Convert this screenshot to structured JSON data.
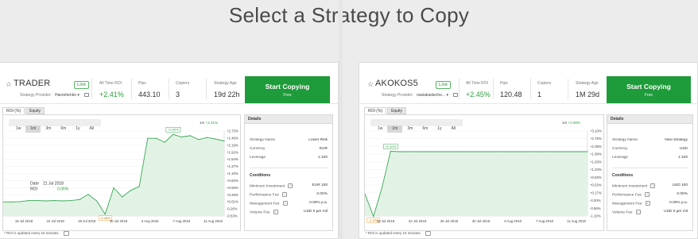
{
  "page": {
    "title": "Select a Strategy to Copy"
  },
  "colors": {
    "accent": "#1e9b3a",
    "chart_line": "#3aa655",
    "chart_fill": "#e2f3e5",
    "loss_marker": "#f0a030"
  },
  "cards": [
    {
      "name": "TRADER",
      "live_label": "Live",
      "provider_label": "Strategy Provider:",
      "provider_name": "Hareshenko ▾",
      "roi_label": "All Time ROI",
      "roi_value": "+2.41%",
      "pips_label": "Pips",
      "pips_value": "443.10",
      "copiers_label": "Copiers",
      "copiers_value": "3",
      "age_label": "Strategy Age",
      "age_value": "19d 22h",
      "copy_label": "Start Copying",
      "copy_sub": "Free",
      "tabs": [
        "ROI (%)",
        "Equity"
      ],
      "ranges": [
        "1w",
        "1m",
        "3m",
        "6m",
        "1y",
        "All"
      ],
      "active_range": "1m",
      "legend_range": "1m",
      "legend_value": "+2.41%",
      "yticks": [
        "+2.73%",
        "+2.46%",
        "+2.19%",
        "+1.92%",
        "+1.64%",
        "+1.37%",
        "+1.10%",
        "+0.82%",
        "+0.55%",
        "+0.28%",
        "+0.01%",
        "-0.26%",
        "-0.53%"
      ],
      "xticks": [
        "19 Jul 2018",
        "22 Jul 2018",
        "26 Jul 2018",
        "30 Jul 2018",
        "3 Aug 2018",
        "7 Aug 2018",
        "11 Aug 2018"
      ],
      "tooltip": {
        "date_label": "Date",
        "date_value": "21 Jul 2018",
        "roi_label": "ROI",
        "roi_value": "0.06%"
      },
      "peak_label": "+2.60%",
      "low_label": "-0.46%",
      "details_title": "Details",
      "details": [
        {
          "label": "Strategy Name",
          "value": "Lower Risk"
        },
        {
          "label": "Currency",
          "value": "EUR"
        },
        {
          "label": "Leverage",
          "value": "1:100"
        }
      ],
      "conditions_title": "Conditions",
      "conditions": [
        {
          "label": "Minimum Investment",
          "value": "EUR 100"
        },
        {
          "label": "Performance Fee",
          "value": "0.00%"
        },
        {
          "label": "Management Fee",
          "value": "0.00% p.a."
        },
        {
          "label": "Volume Fee",
          "value": "USD 0 per mil"
        }
      ],
      "footnote": "* ROI is updated every 15 minutes."
    },
    {
      "name": "AKOKOS5",
      "live_label": "Live",
      "provider_label": "Strategy Provider:",
      "provider_name": "nasiakasteche... ▾",
      "roi_label": "All Time ROI",
      "roi_value": "+2.45%",
      "pips_label": "Pips",
      "pips_value": "120.48",
      "copiers_label": "Copiers",
      "copiers_value": "1",
      "age_label": "Strategy Age",
      "age_value": "1M 29d",
      "copy_label": "Start Copying",
      "copy_sub": "Free",
      "tabs": [
        "ROI (%)",
        "Equity"
      ],
      "ranges": [
        "1w",
        "1m",
        "3m",
        "6m",
        "1y",
        "All"
      ],
      "active_range": "1m",
      "legend_range": "1m",
      "legend_value": "+2.08%",
      "yticks": [
        "+3.10%",
        "+2.75%",
        "+2.38%",
        "+1.99%",
        "+1.63%",
        "+1.23%",
        "+0.83%",
        "+0.53%",
        "+0.17%",
        "-0.20%",
        "-0.56%",
        "-1.10%"
      ],
      "xticks": [
        "19 Jul 2018",
        "22 Jul 2018",
        "26 Jul 2018",
        "30 Jul 2018",
        "3 Aug 2018",
        "7 Aug 2018",
        "11 Aug 2018"
      ],
      "peak_label": "+2.10%",
      "low_label": "-1.12%",
      "details_title": "Details",
      "details": [
        {
          "label": "Strategy Name",
          "value": "New Strategy"
        },
        {
          "label": "Currency",
          "value": "USD"
        },
        {
          "label": "Leverage",
          "value": "1:100"
        }
      ],
      "conditions_title": "Conditions",
      "conditions": [
        {
          "label": "Minimum Investment",
          "value": "USD 100"
        },
        {
          "label": "Performance Fee",
          "value": "0.00%"
        },
        {
          "label": "Management Fee",
          "value": "0.00% p.a."
        },
        {
          "label": "Volume Fee",
          "value": "USD 0 per mil"
        }
      ],
      "footnote": "* ROI is updated every 15 minutes."
    }
  ],
  "chart_data": [
    {
      "type": "area",
      "title": "",
      "x": [
        "18 Jul",
        "19 Jul",
        "20 Jul",
        "21 Jul",
        "22 Jul",
        "23 Jul",
        "24 Jul",
        "25 Jul",
        "26 Jul",
        "27 Jul",
        "28 Jul",
        "29 Jul",
        "30 Jul",
        "31 Jul",
        "1 Aug",
        "2 Aug",
        "3 Aug",
        "4 Aug",
        "5 Aug",
        "6 Aug",
        "7 Aug",
        "8 Aug",
        "9 Aug",
        "10 Aug",
        "11 Aug",
        "12 Aug",
        "13 Aug"
      ],
      "series": [
        {
          "values": [
            0.01,
            0.01,
            0.02,
            0.06,
            0.06,
            0.05,
            0.06,
            0.05,
            0.06,
            0.1,
            0.3,
            0.05,
            -0.46,
            0.55,
            0.2,
            0.45,
            0.6,
            2.45,
            2.45,
            2.3,
            2.6,
            2.5,
            2.55,
            2.4,
            2.48,
            2.42,
            2.35
          ]
        }
      ],
      "ylim": [
        -0.53,
        2.73
      ]
    },
    {
      "type": "area",
      "title": "",
      "x": [
        "18 Jul",
        "19 Jul",
        "20 Jul",
        "21 Jul",
        "22 Jul",
        "23 Jul",
        "24 Jul",
        "25 Jul",
        "26 Jul",
        "27 Jul",
        "28 Jul",
        "29 Jul",
        "30 Jul",
        "31 Jul",
        "1 Aug",
        "2 Aug",
        "3 Aug",
        "4 Aug",
        "5 Aug",
        "6 Aug",
        "7 Aug",
        "8 Aug",
        "9 Aug",
        "10 Aug",
        "11 Aug",
        "12 Aug",
        "13 Aug"
      ],
      "series": [
        {
          "values": [
            0.0,
            -1.12,
            0.3,
            2.1,
            2.08,
            2.08,
            2.08,
            2.08,
            2.08,
            2.08,
            2.08,
            2.08,
            2.08,
            2.08,
            2.08,
            2.08,
            2.08,
            2.08,
            2.08,
            2.08,
            2.08,
            2.08,
            2.08,
            2.08,
            2.08,
            2.08,
            2.08
          ]
        }
      ],
      "ylim": [
        -1.1,
        3.1
      ]
    }
  ]
}
